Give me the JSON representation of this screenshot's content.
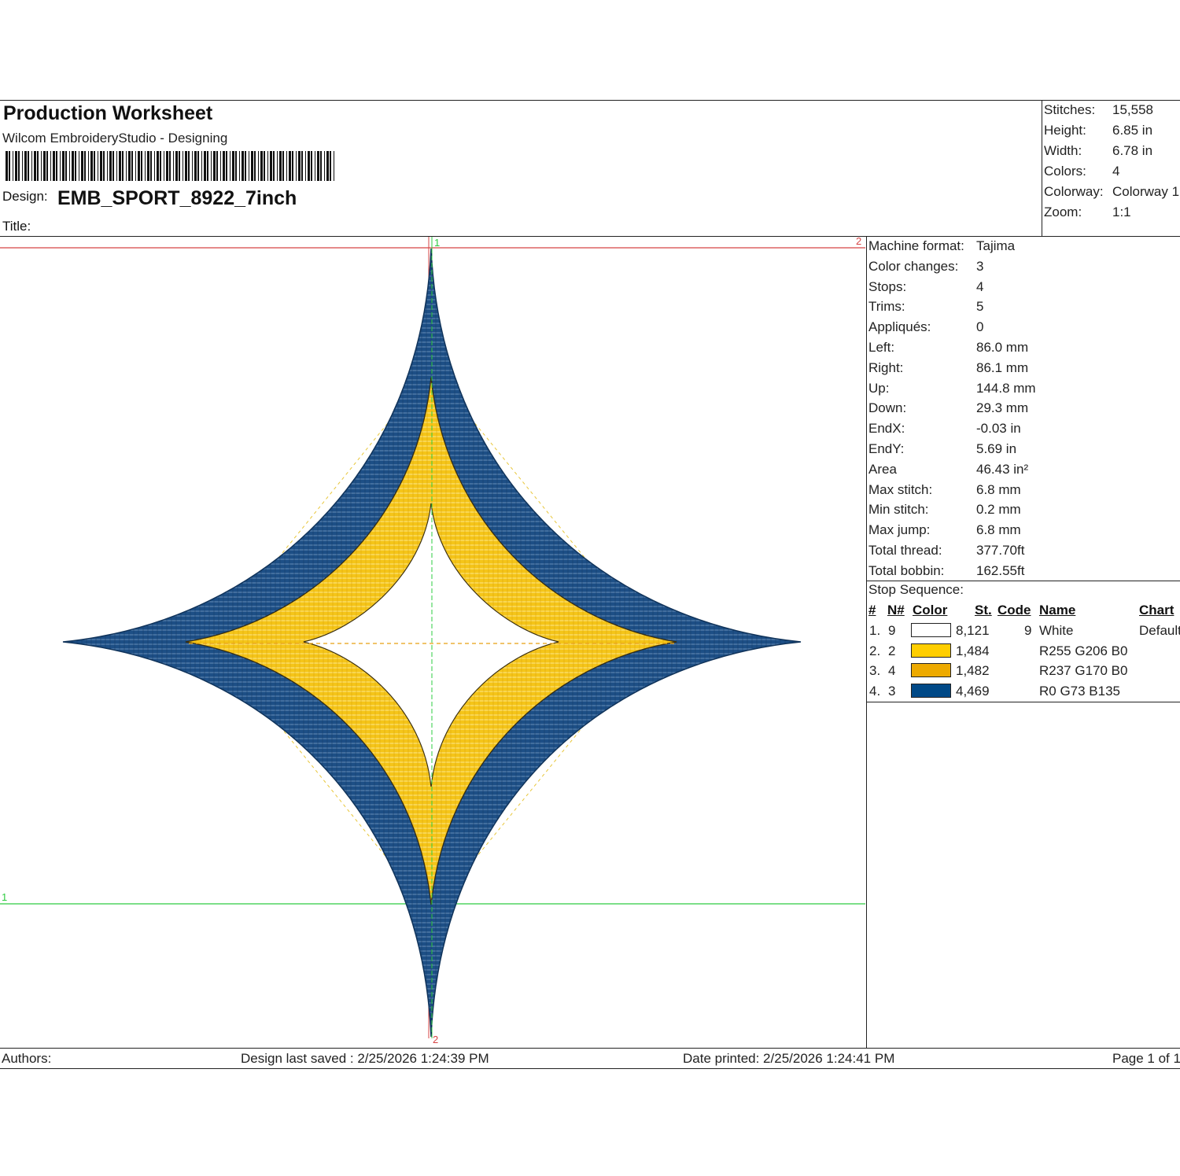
{
  "header": {
    "title": "Production Worksheet",
    "subtitle": "Wilcom EmbroideryStudio - Designing",
    "design_label": "Design:",
    "design_name": "EMB_SPORT_8922_7inch",
    "title_label": "Title:",
    "title_value": ""
  },
  "summary": [
    {
      "label": "Stitches:",
      "value": "15,558"
    },
    {
      "label": "Height:",
      "value": "6.85 in"
    },
    {
      "label": "Width:",
      "value": "6.78 in"
    },
    {
      "label": "Colors:",
      "value": "4"
    },
    {
      "label": "Colorway:",
      "value": "Colorway 1"
    },
    {
      "label": "Zoom:",
      "value": "1:1"
    }
  ],
  "machine_info": [
    {
      "label": "Machine format:",
      "value": "Tajima"
    },
    {
      "label": "Color changes:",
      "value": "3"
    },
    {
      "label": "Stops:",
      "value": "4"
    },
    {
      "label": "Trims:",
      "value": "5"
    },
    {
      "label": "Appliqués:",
      "value": "0"
    },
    {
      "label": "Left:",
      "value": "86.0 mm"
    },
    {
      "label": "Right:",
      "value": "86.1 mm"
    },
    {
      "label": "Up:",
      "value": "144.8 mm"
    },
    {
      "label": "Down:",
      "value": "29.3 mm"
    },
    {
      "label": "EndX:",
      "value": "-0.03 in"
    },
    {
      "label": "EndY:",
      "value": "5.69 in"
    },
    {
      "label": "Area",
      "value": " 46.43 in²"
    },
    {
      "label": "Max stitch:",
      "value": "6.8 mm"
    },
    {
      "label": "Min stitch:",
      "value": "0.2 mm"
    },
    {
      "label": "Max jump:",
      "value": "6.8 mm"
    },
    {
      "label": "Total thread:",
      "value": "377.70ft"
    },
    {
      "label": "Total bobbin:",
      "value": "162.55ft"
    }
  ],
  "stop_sequence": {
    "label": "Stop Sequence:",
    "columns": [
      "#",
      "N#",
      "Color",
      "St.",
      "Code",
      "Name",
      "Chart"
    ],
    "rows": [
      {
        "idx": "1.",
        "n": "9",
        "color": "#ffffff",
        "st": "8,121",
        "code": "9",
        "name": "White",
        "chart": "Default"
      },
      {
        "idx": "2.",
        "n": "2",
        "color": "#ffce00",
        "st": "1,484",
        "code": "",
        "name": "R255 G206 B0",
        "chart": ""
      },
      {
        "idx": "3.",
        "n": "4",
        "color": "#edaa00",
        "st": "1,482",
        "code": "",
        "name": "R237 G170 B0",
        "chart": ""
      },
      {
        "idx": "4.",
        "n": "3",
        "color": "#004987",
        "st": "4,469",
        "code": "",
        "name": "R0 G73 B135",
        "chart": ""
      }
    ]
  },
  "preview": {
    "marker_top_left": "1",
    "marker_top_right": "2",
    "marker_left": "1",
    "marker_bottom": "2",
    "colors": {
      "blue": "#1d4f86",
      "gold": "#f5c518",
      "gold_dark": "#e8b010"
    }
  },
  "footer": {
    "authors": "Authors:",
    "saved": "Design last saved : 2/25/2026 1:24:39 PM",
    "printed": "Date printed: 2/25/2026 1:24:41 PM",
    "page": "Page 1 of 1"
  }
}
